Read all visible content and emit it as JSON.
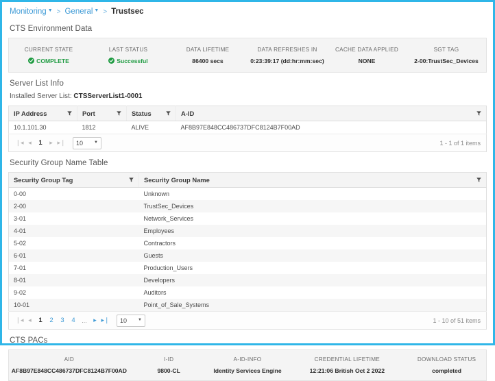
{
  "breadcrumb": {
    "items": [
      {
        "label": "Monitoring",
        "caret": true,
        "current": false
      },
      {
        "label": "General",
        "caret": true,
        "current": false
      },
      {
        "label": "Trustsec",
        "caret": false,
        "current": true
      }
    ],
    "separator": ">"
  },
  "env": {
    "title": "CTS Environment Data",
    "cells": [
      {
        "label": "CURRENT STATE",
        "value": "COMPLETE",
        "icon": "check-circle-icon",
        "status": true
      },
      {
        "label": "LAST STATUS",
        "value": "Successful",
        "icon": "check-circle-icon",
        "status": true
      },
      {
        "label": "DATA LIFETIME",
        "value": "86400 secs",
        "icon": "",
        "status": false
      },
      {
        "label": "DATA REFRESHES IN",
        "value": "0:23:39:17 (dd:hr:mm:sec)",
        "icon": "",
        "status": false
      },
      {
        "label": "CACHE DATA APPLIED",
        "value": "NONE",
        "icon": "",
        "status": false
      },
      {
        "label": "SGT TAG",
        "value": "2-00:TrustSec_Devices",
        "icon": "",
        "status": false
      }
    ]
  },
  "server_list": {
    "title": "Server List Info",
    "installed_label": "Installed Server List:",
    "installed_value": "CTSServerList1-0001",
    "columns": [
      "IP Address",
      "Port",
      "Status",
      "A-ID"
    ],
    "rows": [
      [
        "10.1.101.30",
        "1812",
        "ALIVE",
        "AF8B97E848CC486737DFC8124B7F00AD"
      ]
    ],
    "pager": {
      "first": "❘◂",
      "prev": "◂",
      "pages": [
        "1"
      ],
      "current_page": "1",
      "next": "▸",
      "last": "▸❘",
      "page_size": "10",
      "count_text": "1 - 1 of 1 items"
    }
  },
  "sgt_table": {
    "title": "Security Group Name Table",
    "columns": [
      "Security Group Tag",
      "Security Group Name"
    ],
    "rows": [
      [
        "0-00",
        "Unknown"
      ],
      [
        "2-00",
        "TrustSec_Devices"
      ],
      [
        "3-01",
        "Network_Services"
      ],
      [
        "4-01",
        "Employees"
      ],
      [
        "5-02",
        "Contractors"
      ],
      [
        "6-01",
        "Guests"
      ],
      [
        "7-01",
        "Production_Users"
      ],
      [
        "8-01",
        "Developers"
      ],
      [
        "9-02",
        "Auditors"
      ],
      [
        "10-01",
        "Point_of_Sale_Systems"
      ]
    ],
    "pager": {
      "first": "❘◂",
      "prev": "◂",
      "pages": [
        "1",
        "2",
        "3",
        "4"
      ],
      "ellipsis": "...",
      "current_page": "1",
      "next": "▸",
      "last": "▸❘",
      "page_size": "10",
      "count_text": "1 - 10 of 51 items"
    }
  },
  "pacs": {
    "title": "CTS PACs",
    "cells": [
      {
        "label": "AID",
        "value": "AF8B97E848CC486737DFC8124B7F00AD",
        "wide": true
      },
      {
        "label": "I-ID",
        "value": "9800-CL",
        "wide": false
      },
      {
        "label": "A-ID-INFO",
        "value": "Identity Services Engine",
        "wide": false
      },
      {
        "label": "CREDENTIAL LIFETIME",
        "value": "12:21:06 British Oct 2 2022",
        "wide": true
      },
      {
        "label": "DOWNLOAD STATUS",
        "value": "completed",
        "wide": false
      }
    ]
  },
  "colors": {
    "accent": "#2fb6e8",
    "link": "#3d9ad6",
    "success": "#1f9b42",
    "panel": "#f4f4f4",
    "stripe": "#f6f6f6"
  }
}
